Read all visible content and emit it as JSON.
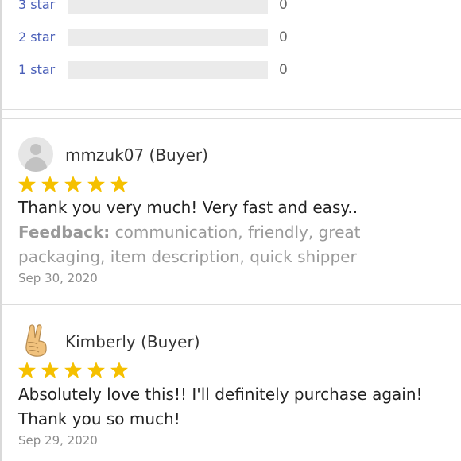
{
  "rating_breakdown": [
    {
      "label": "3 star",
      "count": "0"
    },
    {
      "label": "2 star",
      "count": "0"
    },
    {
      "label": "1 star",
      "count": "0"
    }
  ],
  "star_color": "#f5c000",
  "reviews": [
    {
      "name": "mmzuk07 (Buyer)",
      "avatar": "default-user-avatar",
      "stars": 5,
      "text": "Thank you very much! Very fast and easy..",
      "feedback_label": "Feedback:",
      "feedback_value": " communication, friendly, great packaging, item description, quick shipper",
      "date": "Sep 30, 2020"
    },
    {
      "name": "Kimberly (Buyer)",
      "avatar": "victory-hand-emoji",
      "stars": 5,
      "text": "Absolutely love this!! I'll definitely purchase again! Thank you so much!",
      "date": "Sep 29, 2020"
    }
  ]
}
